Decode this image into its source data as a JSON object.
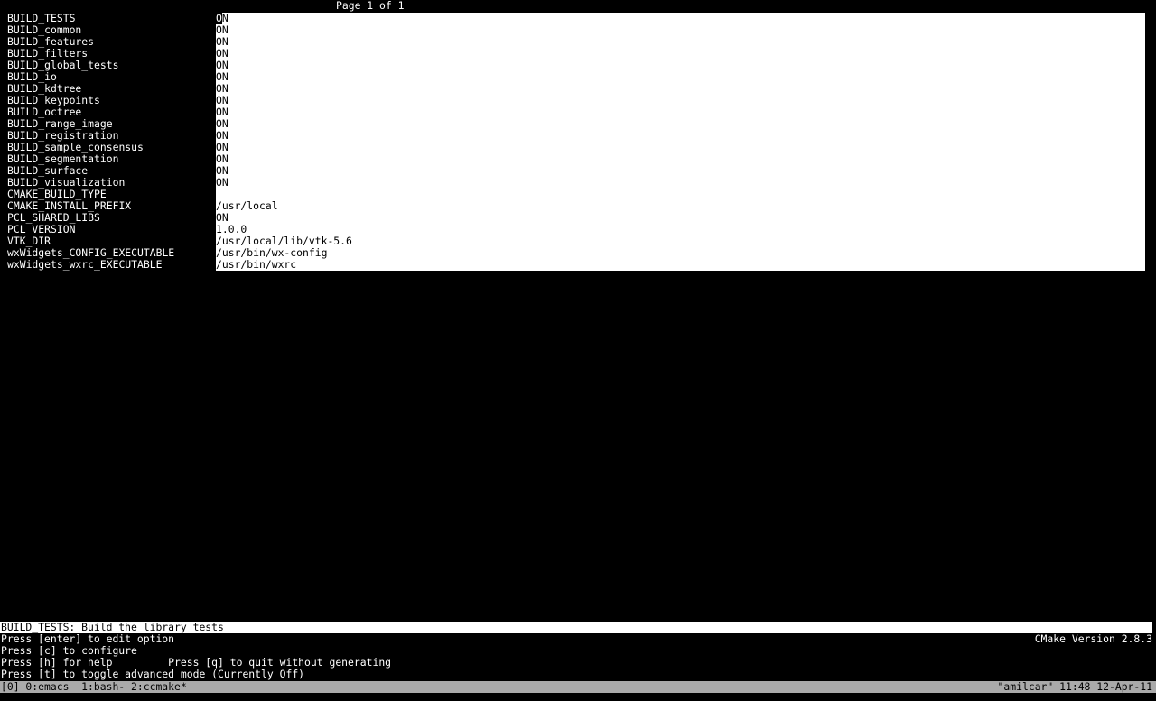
{
  "header": {
    "page_indicator": "Page 1 of 1"
  },
  "entries": [
    {
      "key": "BUILD_TESTS",
      "value": "ON"
    },
    {
      "key": "BUILD_common",
      "value": "ON"
    },
    {
      "key": "BUILD_features",
      "value": "ON"
    },
    {
      "key": "BUILD_filters",
      "value": "ON"
    },
    {
      "key": "BUILD_global_tests",
      "value": "ON"
    },
    {
      "key": "BUILD_io",
      "value": "ON"
    },
    {
      "key": "BUILD_kdtree",
      "value": "ON"
    },
    {
      "key": "BUILD_keypoints",
      "value": "ON"
    },
    {
      "key": "BUILD_octree",
      "value": "ON"
    },
    {
      "key": "BUILD_range_image",
      "value": "ON"
    },
    {
      "key": "BUILD_registration",
      "value": "ON"
    },
    {
      "key": "BUILD_sample_consensus",
      "value": "ON"
    },
    {
      "key": "BUILD_segmentation",
      "value": "ON"
    },
    {
      "key": "BUILD_surface",
      "value": "ON"
    },
    {
      "key": "BUILD_visualization",
      "value": "ON"
    },
    {
      "key": "CMAKE_BUILD_TYPE",
      "value": ""
    },
    {
      "key": "CMAKE_INSTALL_PREFIX",
      "value": "/usr/local"
    },
    {
      "key": "PCL_SHARED_LIBS",
      "value": "ON"
    },
    {
      "key": "PCL_VERSION",
      "value": "1.0.0"
    },
    {
      "key": "VTK_DIR",
      "value": "/usr/local/lib/vtk-5.6"
    },
    {
      "key": "wxWidgets_CONFIG_EXECUTABLE",
      "value": "/usr/bin/wx-config"
    },
    {
      "key": "wxWidgets_wxrc_EXECUTABLE",
      "value": "/usr/bin/wxrc"
    }
  ],
  "selected_index": 0,
  "description": "BUILD_TESTS: Build the library tests",
  "help": {
    "line1": "Press [enter] to edit option",
    "line2": "Press [c] to configure",
    "line3": "Press [h] for help         Press [q] to quit without generating",
    "line4": "Press [t] to toggle advanced mode (Currently Off)"
  },
  "version": "CMake Version 2.8.3",
  "tmux": {
    "left": "[0] 0:emacs  1:bash- 2:ccmake*",
    "right": "\"amilcar\" 11:48 12-Apr-11"
  }
}
